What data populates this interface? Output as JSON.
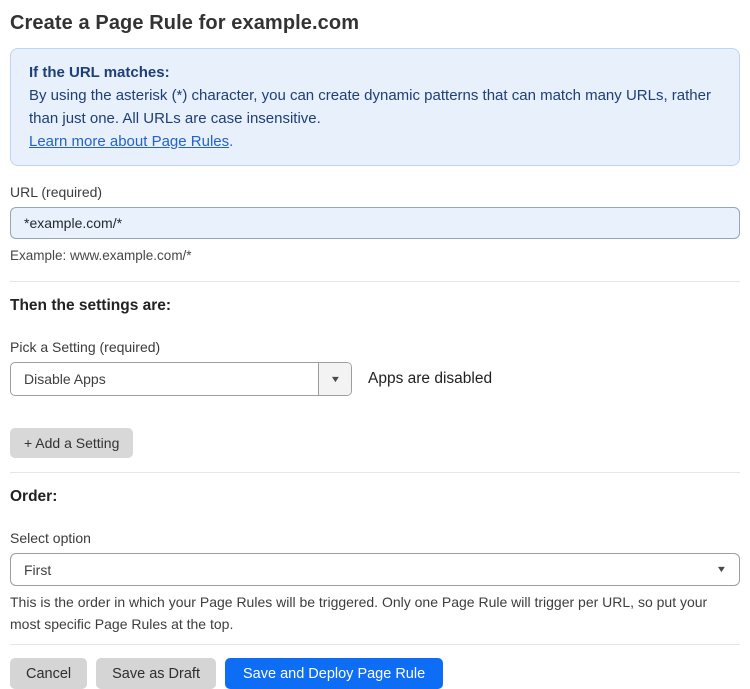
{
  "page": {
    "title": "Create a Page Rule for example.com"
  },
  "info_box": {
    "heading": "If the URL matches:",
    "body": "By using the asterisk (*) character, you can create dynamic patterns that can match many URLs, rather than just one. All URLs are case insensitive.",
    "link_label": "Learn more about Page Rules",
    "link_suffix": "."
  },
  "url_field": {
    "label": "URL (required)",
    "value": "*example.com/*",
    "helper": "Example: www.example.com/*"
  },
  "settings_section": {
    "heading": "Then the settings are:",
    "picker_label": "Pick a Setting (required)",
    "selected_setting": "Disable Apps",
    "setting_description": "Apps are disabled",
    "add_setting_label": "+ Add a Setting"
  },
  "order_section": {
    "heading": "Order:",
    "select_label": "Select option",
    "selected_option": "First",
    "helper": "This is the order in which your Page Rules will be triggered. Only one Page Rule will trigger per URL, so put your most specific Page Rules at the top."
  },
  "footer": {
    "cancel_label": "Cancel",
    "save_draft_label": "Save as Draft",
    "save_deploy_label": "Save and Deploy Page Rule"
  },
  "icons": {
    "caret_down": "▼"
  },
  "colors": {
    "primary_button": "#0d6ef5",
    "info_box_bg": "#e7f0fb",
    "info_box_border": "#bdd5f0",
    "info_text": "#1e3f77",
    "link": "#2462cd",
    "input_bg": "#e9f1fc",
    "gray_button": "#d5d5d5"
  }
}
